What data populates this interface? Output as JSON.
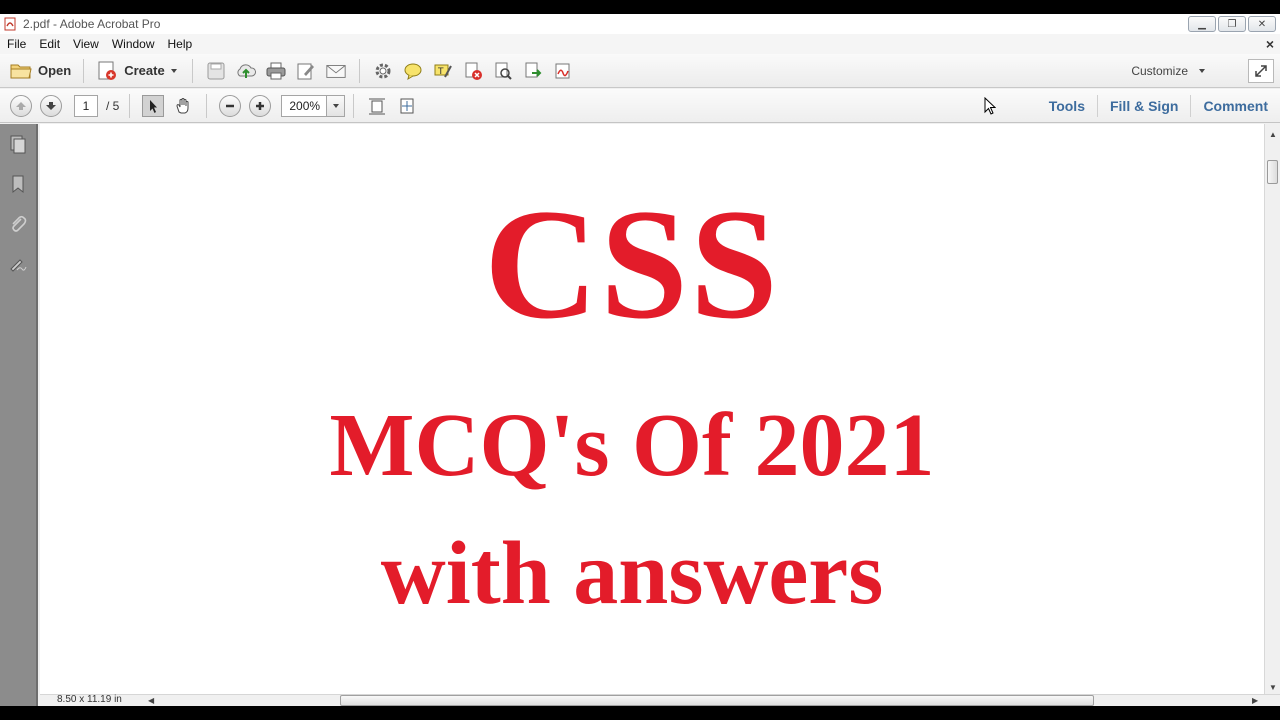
{
  "window": {
    "title": "2.pdf - Adobe Acrobat Pro",
    "controls": {
      "minimize": "▁",
      "restore": "❐",
      "close": "✕"
    }
  },
  "menu": {
    "items": [
      "File",
      "Edit",
      "View",
      "Window",
      "Help"
    ],
    "close_glyph": "×"
  },
  "toolbar": {
    "open_label": "Open",
    "create_label": "Create",
    "customize_label": "Customize",
    "icons": [
      "save-icon",
      "cloud-upload-icon",
      "print-icon",
      "edit-icon",
      "email-icon",
      "settings-icon",
      "comment-icon",
      "highlight-icon",
      "delete-pages-icon",
      "search-pages-icon",
      "export-icon",
      "signature-icon"
    ]
  },
  "nav": {
    "current_page": "1",
    "total_pages": "/ 5",
    "zoom": "200%",
    "pane_links": [
      "Tools",
      "Fill & Sign",
      "Comment"
    ]
  },
  "document": {
    "title": "CSS",
    "subtitle_line1": "MCQ's Of 2021",
    "subtitle_line2": "with answers",
    "text_color": "#e31c2a"
  },
  "status": {
    "page_size": "8.50 x 11.19 in"
  },
  "colors": {
    "link_blue": "#3d6c9e",
    "panel_gray": "#8c8c8c"
  }
}
